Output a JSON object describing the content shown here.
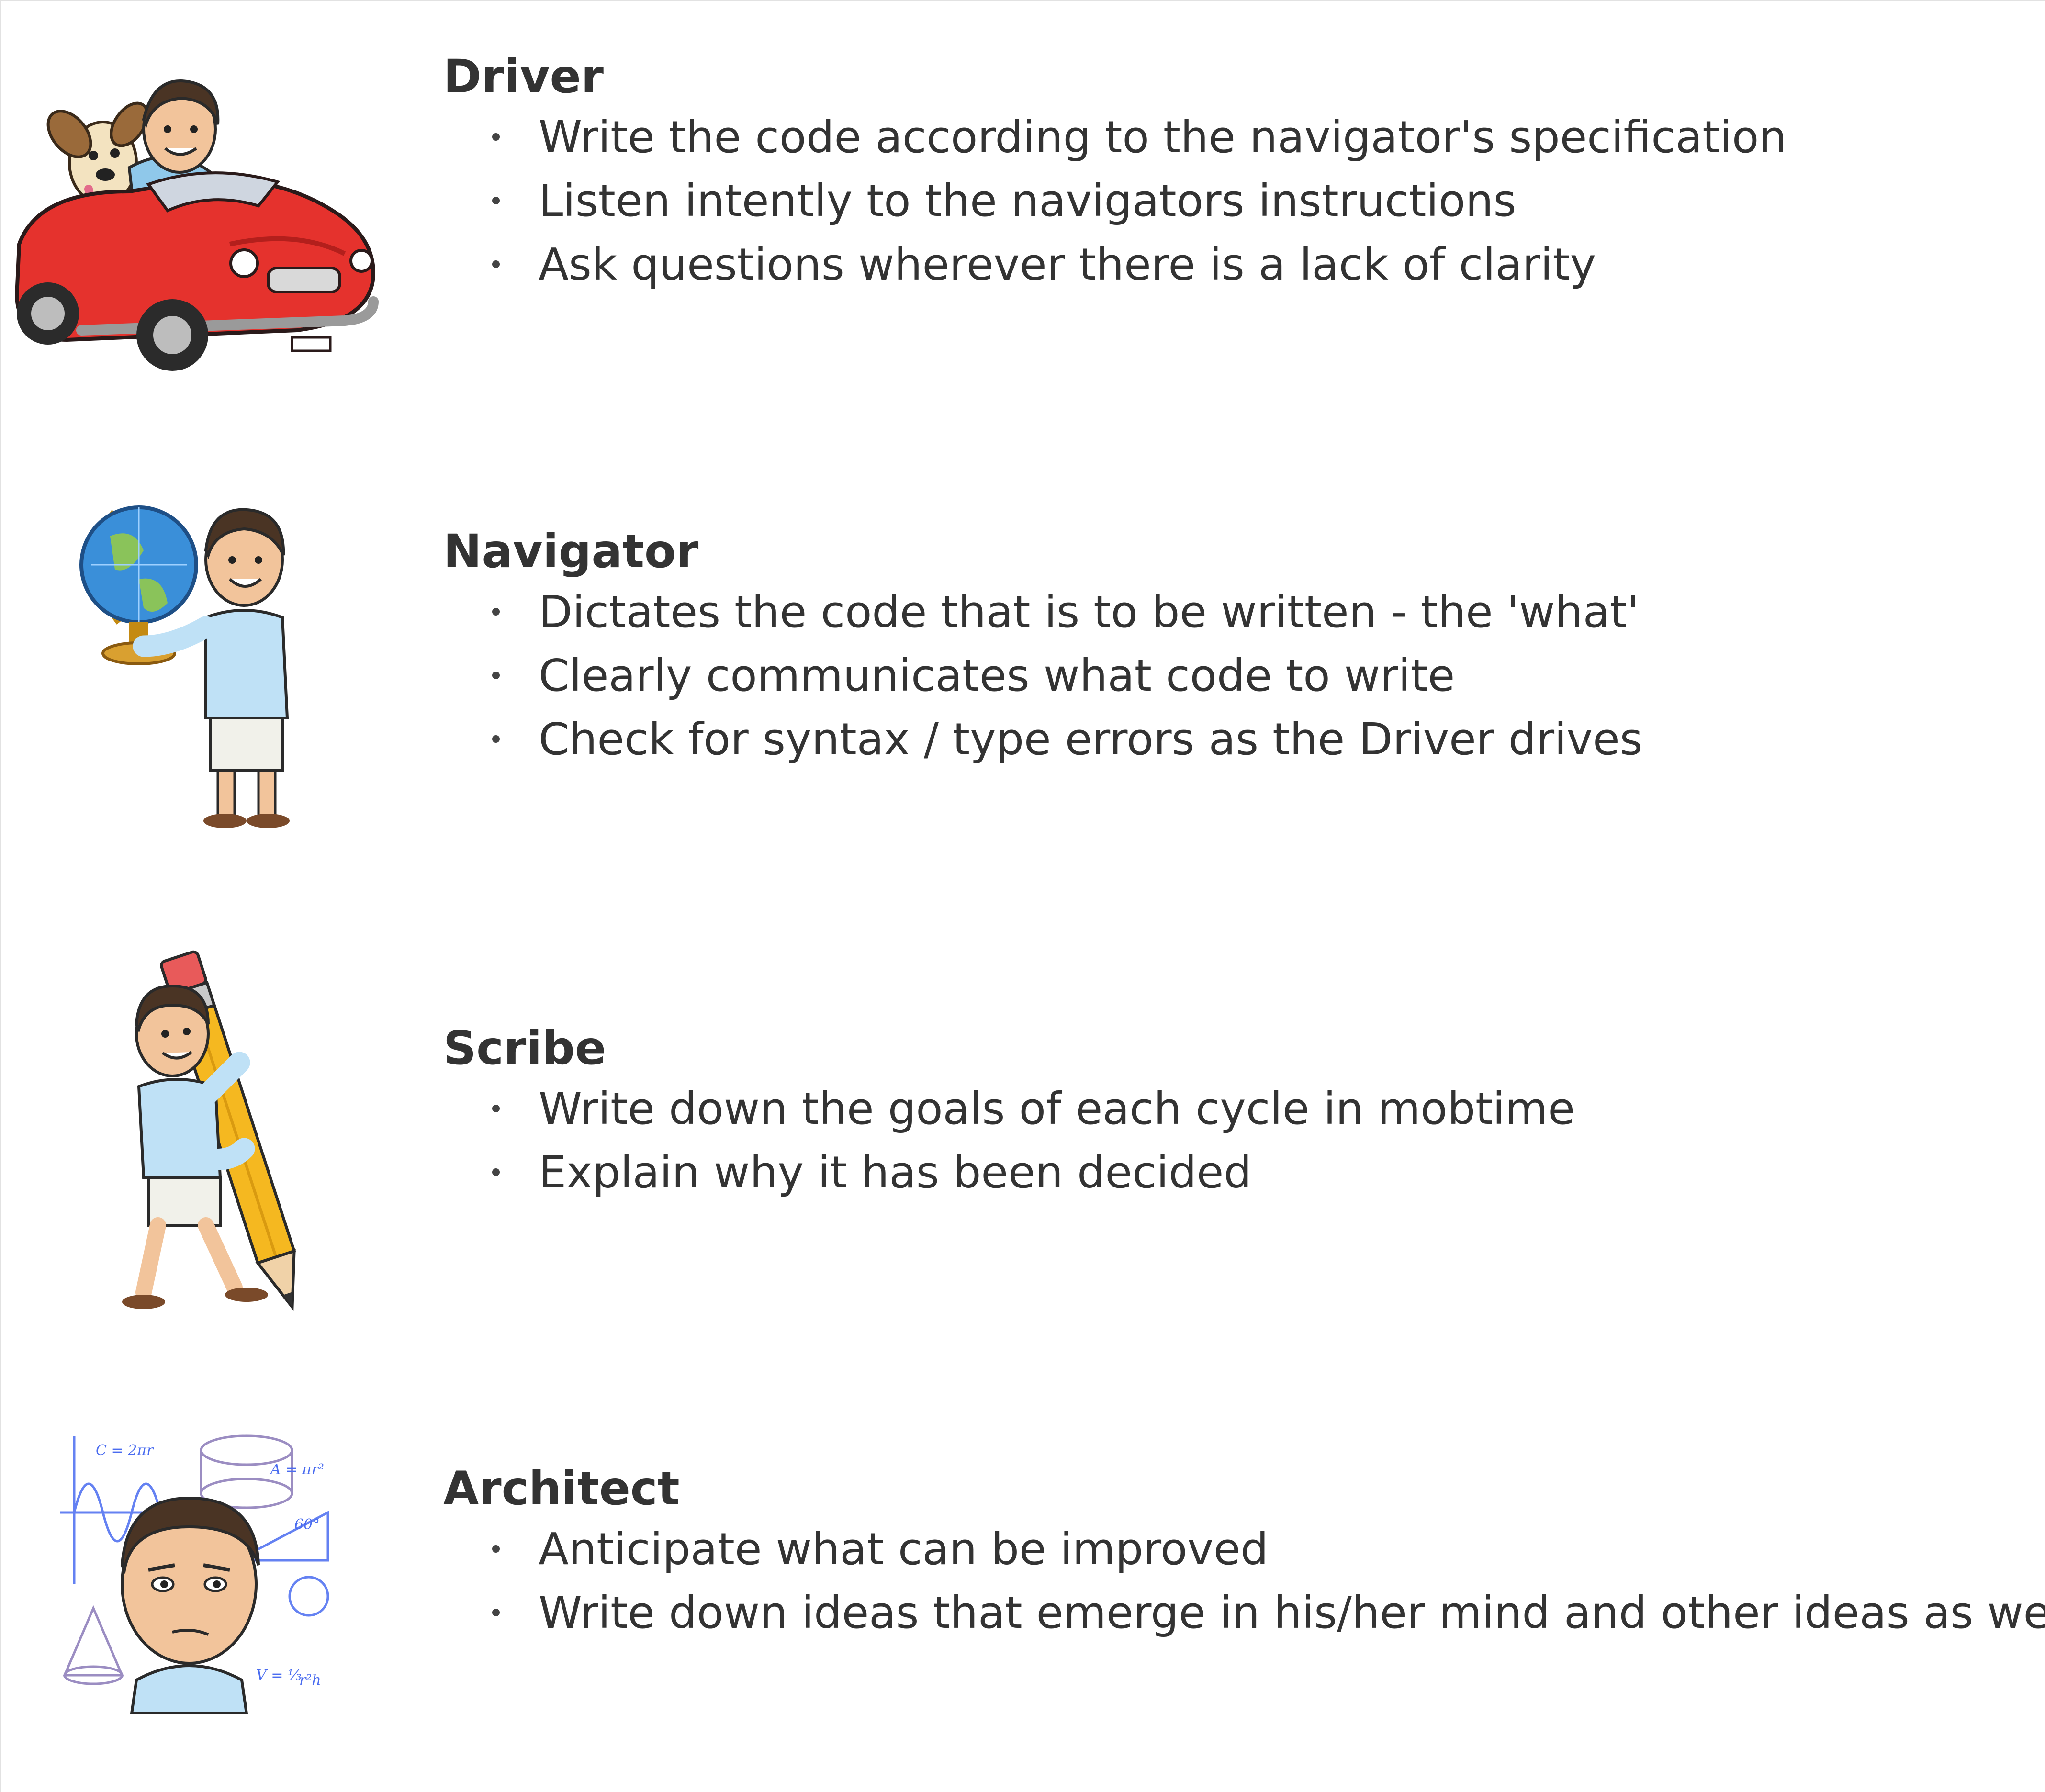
{
  "roles": [
    {
      "id": "driver",
      "title": "Driver",
      "icon": "driver-in-red-car-illustration",
      "items": [
        "Write the code according to the navigator's specification",
        "Listen intently to the navigators instructions",
        "Ask questions wherever there is a lack of clarity"
      ]
    },
    {
      "id": "navigator",
      "title": "Navigator",
      "icon": "navigator-holding-globe-illustration",
      "items": [
        "Dictates the code that is to be written - the 'what'",
        "Clearly communicates what code to write",
        "Check for syntax / type errors as the Driver drives"
      ]
    },
    {
      "id": "scribe",
      "title": "Scribe",
      "icon": "scribe-holding-giant-pencil-illustration",
      "items": [
        "Write down the goals of each cycle in mobtime",
        "Explain why it has been decided"
      ]
    },
    {
      "id": "architect",
      "title": "Architect",
      "icon": "architect-with-math-formulas-illustration",
      "items": [
        "Anticipate what can be improved",
        "Write down ideas that emerge in his/her mind and other ideas as well"
      ]
    }
  ],
  "colors": {
    "text": "#333333",
    "car_red": "#e5322d",
    "globe_blue": "#3a8fd9",
    "pencil_yellow": "#f5b820",
    "formula_blue": "#4a6cf0"
  }
}
